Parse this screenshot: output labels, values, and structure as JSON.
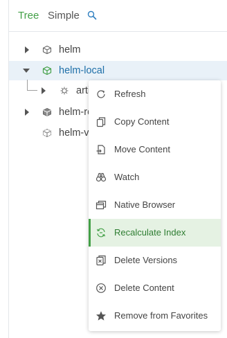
{
  "tabs": {
    "tree": "Tree",
    "simple": "Simple"
  },
  "tree": [
    {
      "label": "helm"
    },
    {
      "label": "helm-local"
    },
    {
      "label": "artifacts"
    },
    {
      "label": "helm-remote"
    },
    {
      "label": "helm-virtual"
    }
  ],
  "menu": {
    "items": [
      {
        "label": "Refresh",
        "icon": "refresh-icon"
      },
      {
        "label": "Copy Content",
        "icon": "copy-icon"
      },
      {
        "label": "Move Content",
        "icon": "move-icon"
      },
      {
        "label": "Watch",
        "icon": "binoculars-icon"
      },
      {
        "label": "Native Browser",
        "icon": "browser-icon"
      },
      {
        "label": "Recalculate Index",
        "icon": "recalculate-icon"
      },
      {
        "label": "Delete Versions",
        "icon": "delete-versions-icon"
      },
      {
        "label": "Delete Content",
        "icon": "delete-content-icon"
      },
      {
        "label": "Remove from Favorites",
        "icon": "star-icon"
      }
    ]
  },
  "colors": {
    "accent": "#43a047",
    "selected_bg": "#e9f1f8",
    "selected_text": "#1e6fa8",
    "active_menu_bg": "#e5f2e3"
  }
}
